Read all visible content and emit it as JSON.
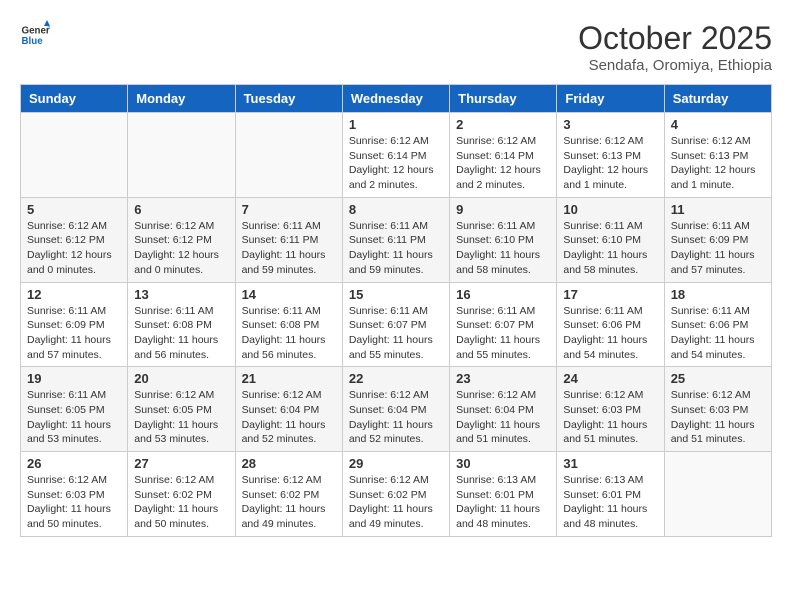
{
  "header": {
    "logo_line1": "General",
    "logo_line2": "Blue",
    "month": "October 2025",
    "location": "Sendafa, Oromiya, Ethiopia"
  },
  "weekdays": [
    "Sunday",
    "Monday",
    "Tuesday",
    "Wednesday",
    "Thursday",
    "Friday",
    "Saturday"
  ],
  "weeks": [
    [
      {
        "day": "",
        "info": ""
      },
      {
        "day": "",
        "info": ""
      },
      {
        "day": "",
        "info": ""
      },
      {
        "day": "1",
        "info": "Sunrise: 6:12 AM\nSunset: 6:14 PM\nDaylight: 12 hours\nand 2 minutes."
      },
      {
        "day": "2",
        "info": "Sunrise: 6:12 AM\nSunset: 6:14 PM\nDaylight: 12 hours\nand 2 minutes."
      },
      {
        "day": "3",
        "info": "Sunrise: 6:12 AM\nSunset: 6:13 PM\nDaylight: 12 hours\nand 1 minute."
      },
      {
        "day": "4",
        "info": "Sunrise: 6:12 AM\nSunset: 6:13 PM\nDaylight: 12 hours\nand 1 minute."
      }
    ],
    [
      {
        "day": "5",
        "info": "Sunrise: 6:12 AM\nSunset: 6:12 PM\nDaylight: 12 hours\nand 0 minutes."
      },
      {
        "day": "6",
        "info": "Sunrise: 6:12 AM\nSunset: 6:12 PM\nDaylight: 12 hours\nand 0 minutes."
      },
      {
        "day": "7",
        "info": "Sunrise: 6:11 AM\nSunset: 6:11 PM\nDaylight: 11 hours\nand 59 minutes."
      },
      {
        "day": "8",
        "info": "Sunrise: 6:11 AM\nSunset: 6:11 PM\nDaylight: 11 hours\nand 59 minutes."
      },
      {
        "day": "9",
        "info": "Sunrise: 6:11 AM\nSunset: 6:10 PM\nDaylight: 11 hours\nand 58 minutes."
      },
      {
        "day": "10",
        "info": "Sunrise: 6:11 AM\nSunset: 6:10 PM\nDaylight: 11 hours\nand 58 minutes."
      },
      {
        "day": "11",
        "info": "Sunrise: 6:11 AM\nSunset: 6:09 PM\nDaylight: 11 hours\nand 57 minutes."
      }
    ],
    [
      {
        "day": "12",
        "info": "Sunrise: 6:11 AM\nSunset: 6:09 PM\nDaylight: 11 hours\nand 57 minutes."
      },
      {
        "day": "13",
        "info": "Sunrise: 6:11 AM\nSunset: 6:08 PM\nDaylight: 11 hours\nand 56 minutes."
      },
      {
        "day": "14",
        "info": "Sunrise: 6:11 AM\nSunset: 6:08 PM\nDaylight: 11 hours\nand 56 minutes."
      },
      {
        "day": "15",
        "info": "Sunrise: 6:11 AM\nSunset: 6:07 PM\nDaylight: 11 hours\nand 55 minutes."
      },
      {
        "day": "16",
        "info": "Sunrise: 6:11 AM\nSunset: 6:07 PM\nDaylight: 11 hours\nand 55 minutes."
      },
      {
        "day": "17",
        "info": "Sunrise: 6:11 AM\nSunset: 6:06 PM\nDaylight: 11 hours\nand 54 minutes."
      },
      {
        "day": "18",
        "info": "Sunrise: 6:11 AM\nSunset: 6:06 PM\nDaylight: 11 hours\nand 54 minutes."
      }
    ],
    [
      {
        "day": "19",
        "info": "Sunrise: 6:11 AM\nSunset: 6:05 PM\nDaylight: 11 hours\nand 53 minutes."
      },
      {
        "day": "20",
        "info": "Sunrise: 6:12 AM\nSunset: 6:05 PM\nDaylight: 11 hours\nand 53 minutes."
      },
      {
        "day": "21",
        "info": "Sunrise: 6:12 AM\nSunset: 6:04 PM\nDaylight: 11 hours\nand 52 minutes."
      },
      {
        "day": "22",
        "info": "Sunrise: 6:12 AM\nSunset: 6:04 PM\nDaylight: 11 hours\nand 52 minutes."
      },
      {
        "day": "23",
        "info": "Sunrise: 6:12 AM\nSunset: 6:04 PM\nDaylight: 11 hours\nand 51 minutes."
      },
      {
        "day": "24",
        "info": "Sunrise: 6:12 AM\nSunset: 6:03 PM\nDaylight: 11 hours\nand 51 minutes."
      },
      {
        "day": "25",
        "info": "Sunrise: 6:12 AM\nSunset: 6:03 PM\nDaylight: 11 hours\nand 51 minutes."
      }
    ],
    [
      {
        "day": "26",
        "info": "Sunrise: 6:12 AM\nSunset: 6:03 PM\nDaylight: 11 hours\nand 50 minutes."
      },
      {
        "day": "27",
        "info": "Sunrise: 6:12 AM\nSunset: 6:02 PM\nDaylight: 11 hours\nand 50 minutes."
      },
      {
        "day": "28",
        "info": "Sunrise: 6:12 AM\nSunset: 6:02 PM\nDaylight: 11 hours\nand 49 minutes."
      },
      {
        "day": "29",
        "info": "Sunrise: 6:12 AM\nSunset: 6:02 PM\nDaylight: 11 hours\nand 49 minutes."
      },
      {
        "day": "30",
        "info": "Sunrise: 6:13 AM\nSunset: 6:01 PM\nDaylight: 11 hours\nand 48 minutes."
      },
      {
        "day": "31",
        "info": "Sunrise: 6:13 AM\nSunset: 6:01 PM\nDaylight: 11 hours\nand 48 minutes."
      },
      {
        "day": "",
        "info": ""
      }
    ]
  ]
}
